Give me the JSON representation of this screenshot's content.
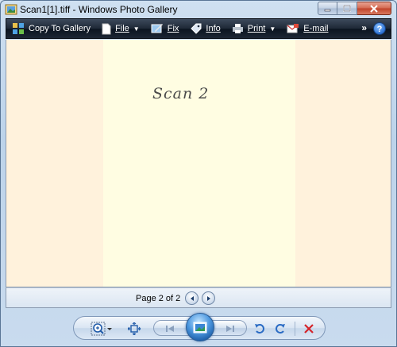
{
  "window": {
    "title": "Scan1[1].tiff - Windows Photo Gallery"
  },
  "toolbar": {
    "items": [
      {
        "label": "Copy To Gallery",
        "icon": "copy-to-gallery-icon"
      },
      {
        "label": "File",
        "icon": "file-icon",
        "has_dropdown": true
      },
      {
        "label": "Fix",
        "icon": "fix-icon"
      },
      {
        "label": "Info",
        "icon": "info-icon"
      },
      {
        "label": "Print",
        "icon": "print-icon",
        "has_dropdown": true
      },
      {
        "label": "E-mail",
        "icon": "email-icon"
      }
    ],
    "more": "»",
    "help": "?"
  },
  "viewer": {
    "image_text": "Scan 2"
  },
  "pagebar": {
    "label": "Page 2 of 2"
  },
  "controls": {
    "icons": [
      "zoom-icon",
      "actual-size-icon",
      "previous-icon",
      "slideshow-icon",
      "next-icon",
      "rotate-counterclockwise-icon",
      "rotate-clockwise-icon",
      "delete-icon"
    ]
  },
  "colors": {
    "toolbar_bg": "#1e2836",
    "viewer_bg": "#fff2dc",
    "page_bg": "#fffde2",
    "delete_red": "#d4242a",
    "rotate_blue": "#2a6bc4"
  }
}
